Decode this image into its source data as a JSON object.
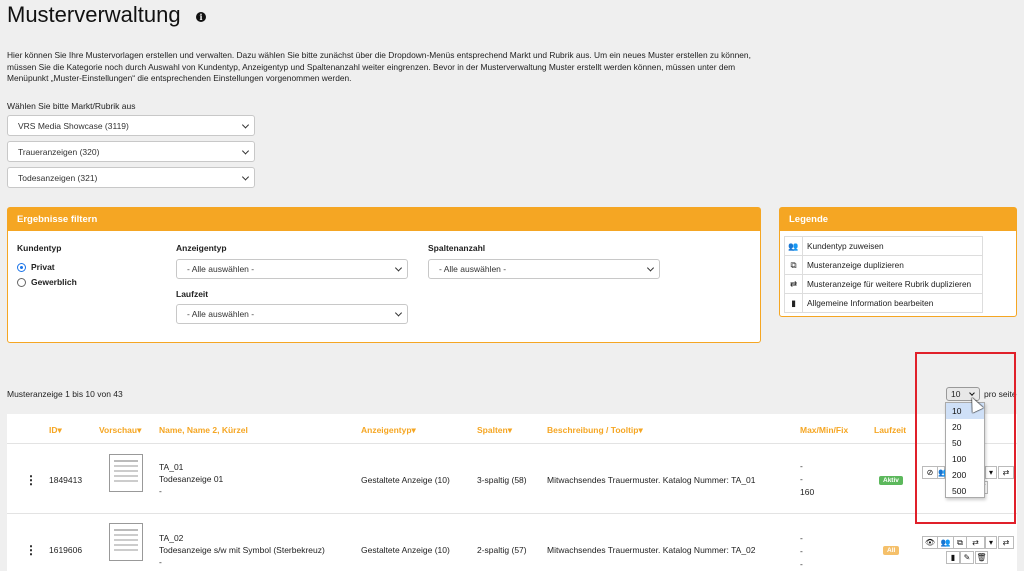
{
  "page": {
    "title": "Musterverwaltung",
    "intro": "Hier können Sie Ihre Mustervorlagen erstellen und verwalten. Dazu wählen Sie bitte zunächst über die Dropdown-Menüs entsprechend Markt und Rubrik aus. Um ein neues Muster erstellen zu können, müssen Sie die Kategorie noch durch Auswahl von Kundentyp, Anzeigentyp und Spaltenanzahl weiter eingrenzen. Bevor in der Musterverwaltung Muster erstellt werden können, müssen unter dem Menüpunkt „Muster-Einstellungen“ die entsprechenden Einstellungen vorgenommen werden."
  },
  "market_select": {
    "label": "Wählen Sie bitte Markt/Rubrik aus",
    "market": "VRS Media Showcase (3119)",
    "rubric": "Traueranzeigen (320)",
    "category": "Todesanzeigen (321)"
  },
  "filter": {
    "title": "Ergebnisse filtern",
    "kundentyp_label": "Kundentyp",
    "kundentyp_options": [
      "Privat",
      "Gewerblich"
    ],
    "anzeigentyp_label": "Anzeigentyp",
    "anzeigentyp_value": "- Alle auswählen -",
    "spalten_label": "Spaltenanzahl",
    "spalten_value": "- Alle auswählen -",
    "laufzeit_label": "Laufzeit",
    "laufzeit_value": "- Alle auswählen -"
  },
  "legend": {
    "title": "Legende",
    "items": [
      {
        "icon": "users-icon",
        "label": "Kundentyp zuweisen"
      },
      {
        "icon": "copy-icon",
        "label": "Musteranzeige duplizieren"
      },
      {
        "icon": "retweet-icon",
        "label": "Musteranzeige für weitere Rubrik duplizieren"
      },
      {
        "icon": "file-icon",
        "label": "Allgemeine Information bearbeiten"
      }
    ]
  },
  "results": {
    "count_text": "Musteranzeige 1 bis 10 von 43",
    "per_page_value": "10",
    "per_page_label": "pro seite",
    "per_page_options": [
      "10",
      "20",
      "50",
      "100",
      "200",
      "500"
    ]
  },
  "table": {
    "headers": {
      "id": "ID",
      "vorschau": "Vorschau",
      "name": "Name, Name 2, Kürzel",
      "anzeigentyp": "Anzeigentyp",
      "spalten": "Spalten",
      "beschreibung": "Beschreibung / Tooltip",
      "maxminfix": "Max/Min/Fix",
      "laufzeit": "Laufzeit"
    },
    "rows": [
      {
        "id": "1849413",
        "name1": "TA_01",
        "name2": "Todesanzeige 01",
        "kuerzel": "-",
        "anzeigentyp": "Gestaltete Anzeige (10)",
        "spalten": "3-spaltig (58)",
        "beschreibung": "Mitwachsendes Trauermuster. Katalog Nummer: TA_01",
        "max": "-",
        "min": "-",
        "fix": "160",
        "laufzeit": "Aktiv"
      },
      {
        "id": "1619606",
        "name1": "TA_02",
        "name2": "Todesanzeige s/w mit Symbol (Sterbekreuz)",
        "kuerzel": "-",
        "anzeigentyp": "Gestaltete Anzeige (10)",
        "spalten": "2-spaltig (57)",
        "beschreibung": "Mitwachsendes Trauermuster. Katalog Nummer: TA_02",
        "max": "-",
        "min": "-",
        "fix": "-",
        "laufzeit": "All"
      }
    ]
  },
  "colors": {
    "accent": "#f5a623",
    "active_badge": "#5cb85c",
    "highlight": "#e0202a"
  }
}
